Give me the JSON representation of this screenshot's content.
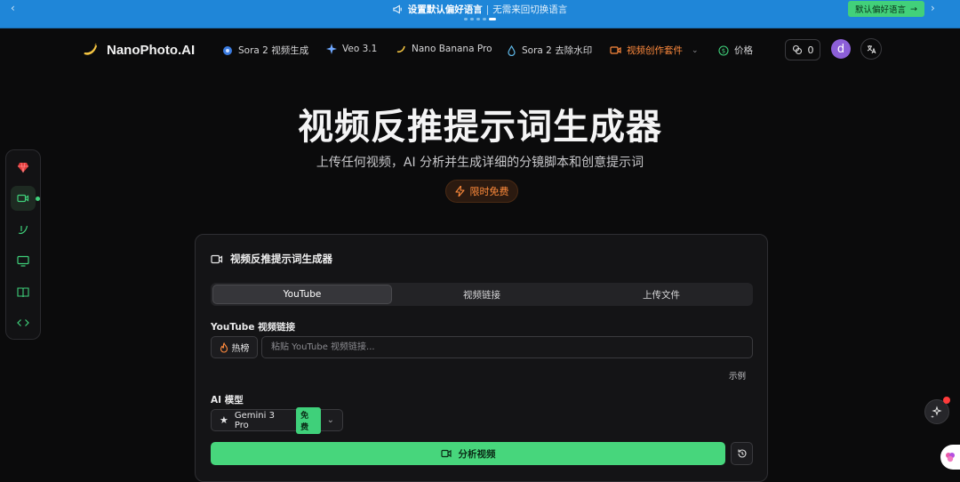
{
  "announcement": {
    "title": "设置默认偏好语言",
    "subtitle": "无需来回切换语言",
    "action_label": "默认偏好语言",
    "carousel_total": 5,
    "carousel_active": 5
  },
  "header": {
    "brand": "NanoPhoto.AI",
    "nav": [
      {
        "label": "Sora 2 视频生成",
        "icon": "sora-icon"
      },
      {
        "label": "Veo 3.1",
        "icon": "veo-sparkle-icon"
      },
      {
        "label": "Nano Banana Pro",
        "icon": "banana-icon"
      },
      {
        "label": "Sora 2 去除水印",
        "icon": "droplet-icon"
      },
      {
        "label": "视频创作套件",
        "icon": "video-camera-icon",
        "accent": true
      },
      {
        "label": "价格",
        "icon": "dollar-icon"
      }
    ],
    "credits": "0",
    "avatar_letter": "d"
  },
  "hero": {
    "title": "视频反推提示词生成器",
    "subtitle": "上传任何视频，AI 分析并生成详细的分镜脚本和创意提示词",
    "badge": "限时免费"
  },
  "card": {
    "title": "视频反推提示词生成器",
    "tabs": [
      "YouTube",
      "视频链接",
      "上传文件"
    ],
    "active_tab": "YouTube",
    "url_label": "YouTube 视频链接",
    "hot_label": "热榜",
    "url_placeholder": "粘贴 YouTube 视频链接...",
    "url_value": "",
    "example_label": "示例",
    "model_label": "AI 模型",
    "model_value": "Gemini 3 Pro",
    "model_badge": "免费",
    "analyze_label": "分析视频"
  },
  "colors": {
    "accent_green": "#47d67c",
    "accent_orange": "#ff8a3d",
    "banner_blue": "#1f86d8"
  }
}
